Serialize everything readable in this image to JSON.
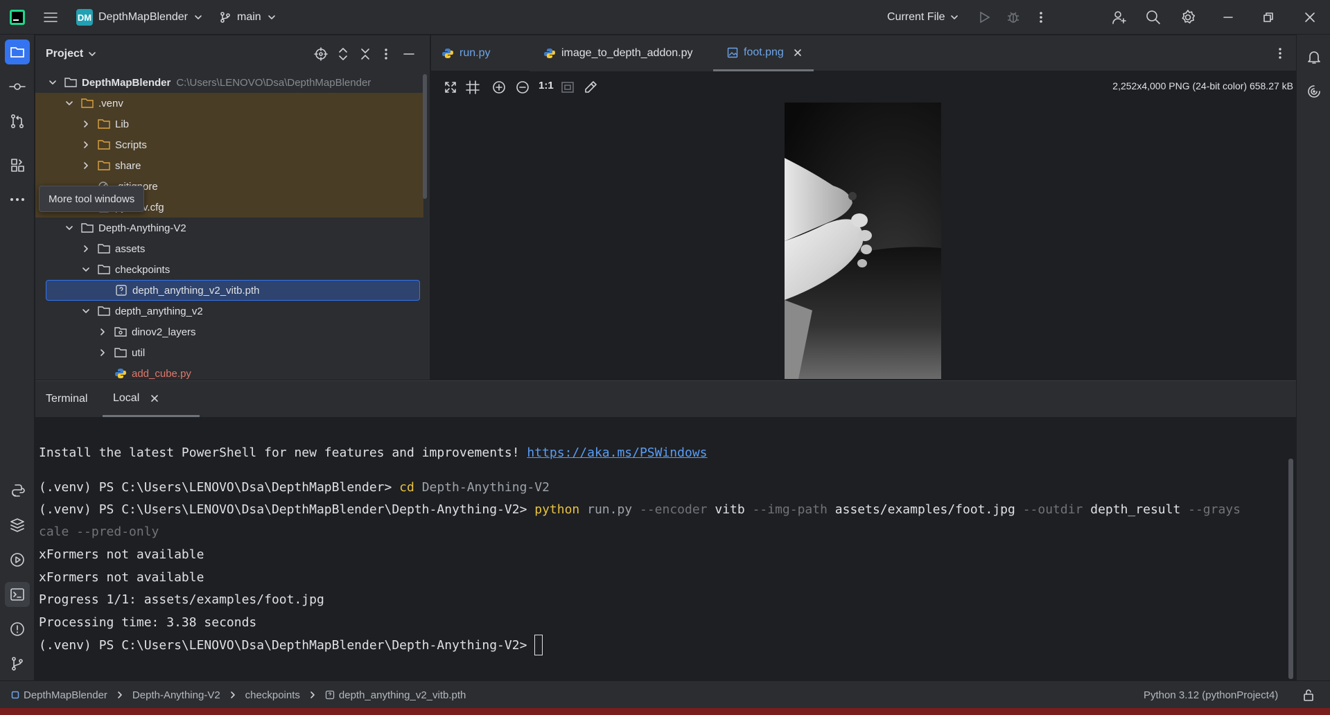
{
  "titlebar": {
    "project_badge": "DM",
    "project_name": "DepthMapBlender",
    "branch": "main",
    "run_config": "Current File"
  },
  "tooltip": {
    "text": "More tool windows"
  },
  "project_panel": {
    "title": "Project",
    "tree": [
      {
        "label": "DepthMapBlender",
        "hint": "C:\\Users\\LENOVO\\Dsa\\DepthMapBlender"
      },
      {
        "label": ".venv"
      },
      {
        "label": "Lib"
      },
      {
        "label": "Scripts"
      },
      {
        "label": "share"
      },
      {
        "label": ".gitignore"
      },
      {
        "label": "pyvenv.cfg"
      },
      {
        "label": "Depth-Anything-V2"
      },
      {
        "label": "assets"
      },
      {
        "label": "checkpoints"
      },
      {
        "label": "depth_anything_v2_vitb.pth"
      },
      {
        "label": "depth_anything_v2"
      },
      {
        "label": "dinov2_layers"
      },
      {
        "label": "util"
      },
      {
        "label": "add_cube.py"
      }
    ]
  },
  "editor": {
    "tabs": [
      {
        "label": "run.py"
      },
      {
        "label": "image_to_depth_addon.py"
      },
      {
        "label": "foot.png"
      }
    ],
    "image_info": "2,252x4,000 PNG (24-bit color) 658.27 kB",
    "zoom_actual": "1:1"
  },
  "terminal": {
    "title": "Terminal",
    "tab": "Local",
    "lines": {
      "ps_text": "Install the latest PowerShell for new features and improvements! ",
      "ps_link": "https://aka.ms/PSWindows",
      "l1_prompt": "(.venv) PS C:\\Users\\LENOVO\\Dsa\\DepthMapBlender> ",
      "l1_cmd": "cd",
      "l1_arg": " Depth-Anything-V2",
      "l2_prompt": "(.venv) PS C:\\Users\\LENOVO\\Dsa\\DepthMapBlender\\Depth-Anything-V2> ",
      "l2_cmd": "python",
      "l2_a": " run.py ",
      "l2_b": "--encoder",
      "l2_c": " vitb ",
      "l2_d": "--img-path",
      "l2_e": " assets/examples/foot.jpg ",
      "l2_f": "--outdir",
      "l2_g": " depth_result ",
      "l2_h": "--grays",
      "l3": "cale --pred-only",
      "l4": "xFormers not available",
      "l5": "xFormers not available",
      "l6": "Progress 1/1: assets/examples/foot.jpg",
      "l7": "Processing time: 3.38 seconds",
      "l8_prompt": "(.venv) PS C:\\Users\\LENOVO\\Dsa\\DepthMapBlender\\Depth-Anything-V2> "
    }
  },
  "statusbar": {
    "crumbs": [
      "DepthMapBlender",
      "Depth-Anything-V2",
      "checkpoints",
      "depth_anything_v2_vitb.pth"
    ],
    "interpreter": "Python 3.12 (pythonProject4)"
  },
  "colors": {
    "accent": "#3574f0",
    "venv_highlight": "#4a3d25",
    "keyword": "#e8c242"
  }
}
